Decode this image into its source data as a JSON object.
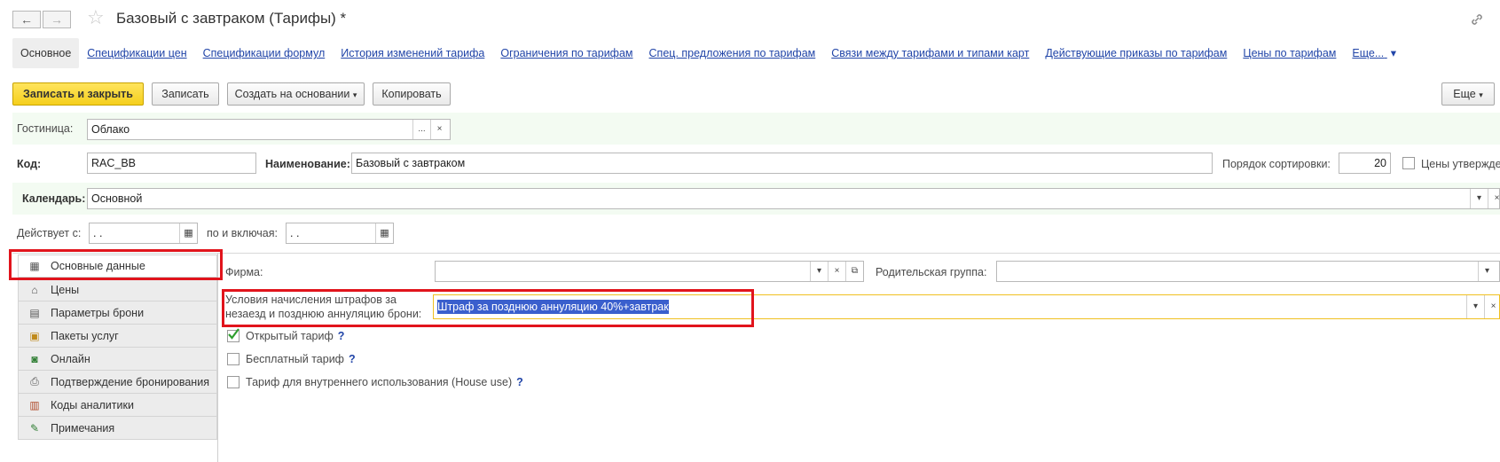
{
  "window": {
    "title": "Базовый с завтраком (Тарифы) *",
    "back_icon": "←",
    "forward_icon": "→",
    "star_icon": "☆",
    "link_icon": "🔗"
  },
  "tabs": [
    "Основное",
    "Спецификации цен",
    "Спецификации формул",
    "История изменений тарифа",
    "Ограничения по тарифам",
    "Спец. предложения по тарифам",
    "Связи между тарифами и типами карт",
    "Действующие приказы по тарифам",
    "Цены по тарифам",
    "Еще..."
  ],
  "toolbar": {
    "save_close": "Записать и закрыть",
    "save": "Записать",
    "create_based": "Создать на основании",
    "copy": "Копировать",
    "more": "Еще"
  },
  "form": {
    "hotel_label": "Гостиница:",
    "hotel_value": "Облако",
    "code_label": "Код:",
    "code_value": "RAC_BB",
    "name_label": "Наименование:",
    "name_value": "Базовый с завтраком",
    "sort_label": "Порядок сортировки:",
    "sort_value": "20",
    "prices_approved_label": "Цены утвержде",
    "calendar_label": "Календарь:",
    "calendar_value": "Основной",
    "valid_from_label": "Действует с:",
    "valid_from_value": " .  .",
    "valid_to_label": "по и включая:",
    "valid_to_value": " .  ."
  },
  "sidebar": [
    {
      "label": "Основные данные",
      "icon": "table-icon",
      "glyph": "▦"
    },
    {
      "label": "Цены",
      "icon": "prices-icon",
      "glyph": "⌂"
    },
    {
      "label": "Параметры брони",
      "icon": "document-icon",
      "glyph": "▤"
    },
    {
      "label": "Пакеты услуг",
      "icon": "package-icon",
      "glyph": "▣"
    },
    {
      "label": "Онлайн",
      "icon": "online-icon",
      "glyph": "◙"
    },
    {
      "label": "Подтверждение бронирования",
      "icon": "printer-icon",
      "glyph": "⎙"
    },
    {
      "label": "Коды аналитики",
      "icon": "chart-icon",
      "glyph": "▥"
    },
    {
      "label": "Примечания",
      "icon": "pencil-icon",
      "glyph": "✎"
    }
  ],
  "main": {
    "firm_label": "Фирма:",
    "firm_value": "",
    "parent_group_label": "Родительская группа:",
    "parent_group_value": "",
    "penalty_label_line1": "Условия начисления штрафов за",
    "penalty_label_line2": "незаезд и позднюю аннуляцию брони:",
    "penalty_value": "Штраф за позднюю аннуляцию 40%+завтрак",
    "open_tariff": {
      "label": "Открытый тариф",
      "checked": true
    },
    "free_tariff": {
      "label": "Бесплатный тариф",
      "checked": false
    },
    "house_use": {
      "label": "Тариф для внутреннего использования (House use)",
      "checked": false
    },
    "help": "?"
  },
  "colors": {
    "accent_yellow": "#f5cf1c",
    "link_blue": "#2145a8",
    "highlight_red": "#e1141c",
    "selection_blue": "#3a5fcd",
    "green_bg": "#f3fbf2"
  }
}
